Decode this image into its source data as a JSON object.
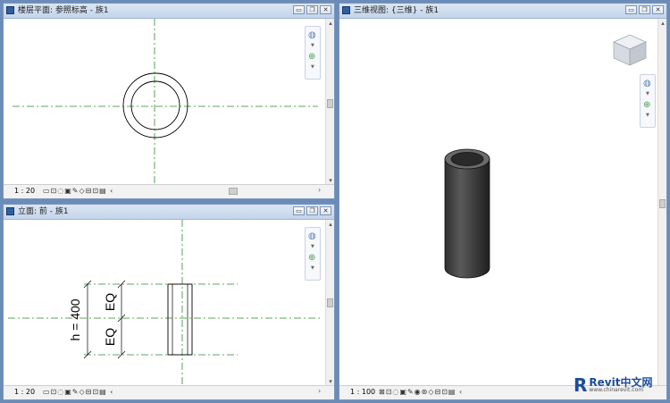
{
  "views": {
    "plan": {
      "title": "楼层平面: 参照标高 - 族1",
      "scale": "1 : 20"
    },
    "elevation": {
      "title": "立面: 前 - 族1",
      "scale": "1 : 20",
      "dimension_label": "h = 400",
      "eq_top": "EQ",
      "eq_bottom": "EQ"
    },
    "threeD": {
      "title": "三维视图: {三维} - 族1",
      "scale": "1 : 100"
    }
  },
  "window_buttons": {
    "minimize": "▭",
    "restore": "❐",
    "close": "✕"
  },
  "icons": {
    "view_cube": "view-cube-icon",
    "steering_wheel": "steering-wheel-icon",
    "zoom": "zoom-icon",
    "view_controls": "view-control-icons"
  },
  "statusbar_icons": "▭⊡◌▣✎◇⊟⊡▤ ‹",
  "statusbar_icons_3d": "⊠⊡◌▣✎◉⊛◇⊟⊡▤ ‹",
  "scroll": {
    "up": "▴",
    "down": "▾",
    "right": "›"
  },
  "brand": {
    "logo": "R",
    "name": "Revit中文网",
    "url": "www.chinarevit.com"
  },
  "colors": {
    "reference_plane": "#2a8a2a",
    "model_line": "#000000",
    "titlebar": "#c3d4ea",
    "brand": "#1c4c9c"
  }
}
